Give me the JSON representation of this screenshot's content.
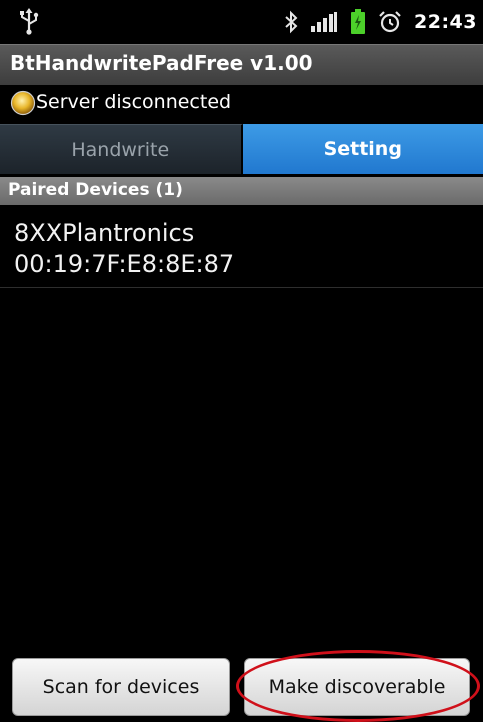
{
  "status_bar": {
    "time": "22:43",
    "icons": [
      "usb-icon",
      "bluetooth-icon",
      "signal-icon",
      "battery-icon",
      "alarm-icon"
    ],
    "colors": {
      "battery": "#4cd02a"
    }
  },
  "app": {
    "title": "BtHandwritePadFree v1.00"
  },
  "server": {
    "status_text": "Server disconnected",
    "indicator_icon": "status-led-icon",
    "indicator_color": "#e8b62a"
  },
  "tabs": [
    {
      "label": "Handwrite",
      "active": false
    },
    {
      "label": "Setting",
      "active": true
    }
  ],
  "paired_section": {
    "header": "Paired Devices (1)"
  },
  "devices": [
    {
      "name": "8XXPlantronics",
      "address": "00:19:7F:E8:8E:87"
    }
  ],
  "buttons": {
    "scan": "Scan for devices",
    "discoverable": "Make discoverable"
  },
  "annotation": {
    "highlight_color": "#d0101a"
  },
  "colors": {
    "accent_tab": "#2f8ae0",
    "section_header": "#7a7a7a"
  }
}
